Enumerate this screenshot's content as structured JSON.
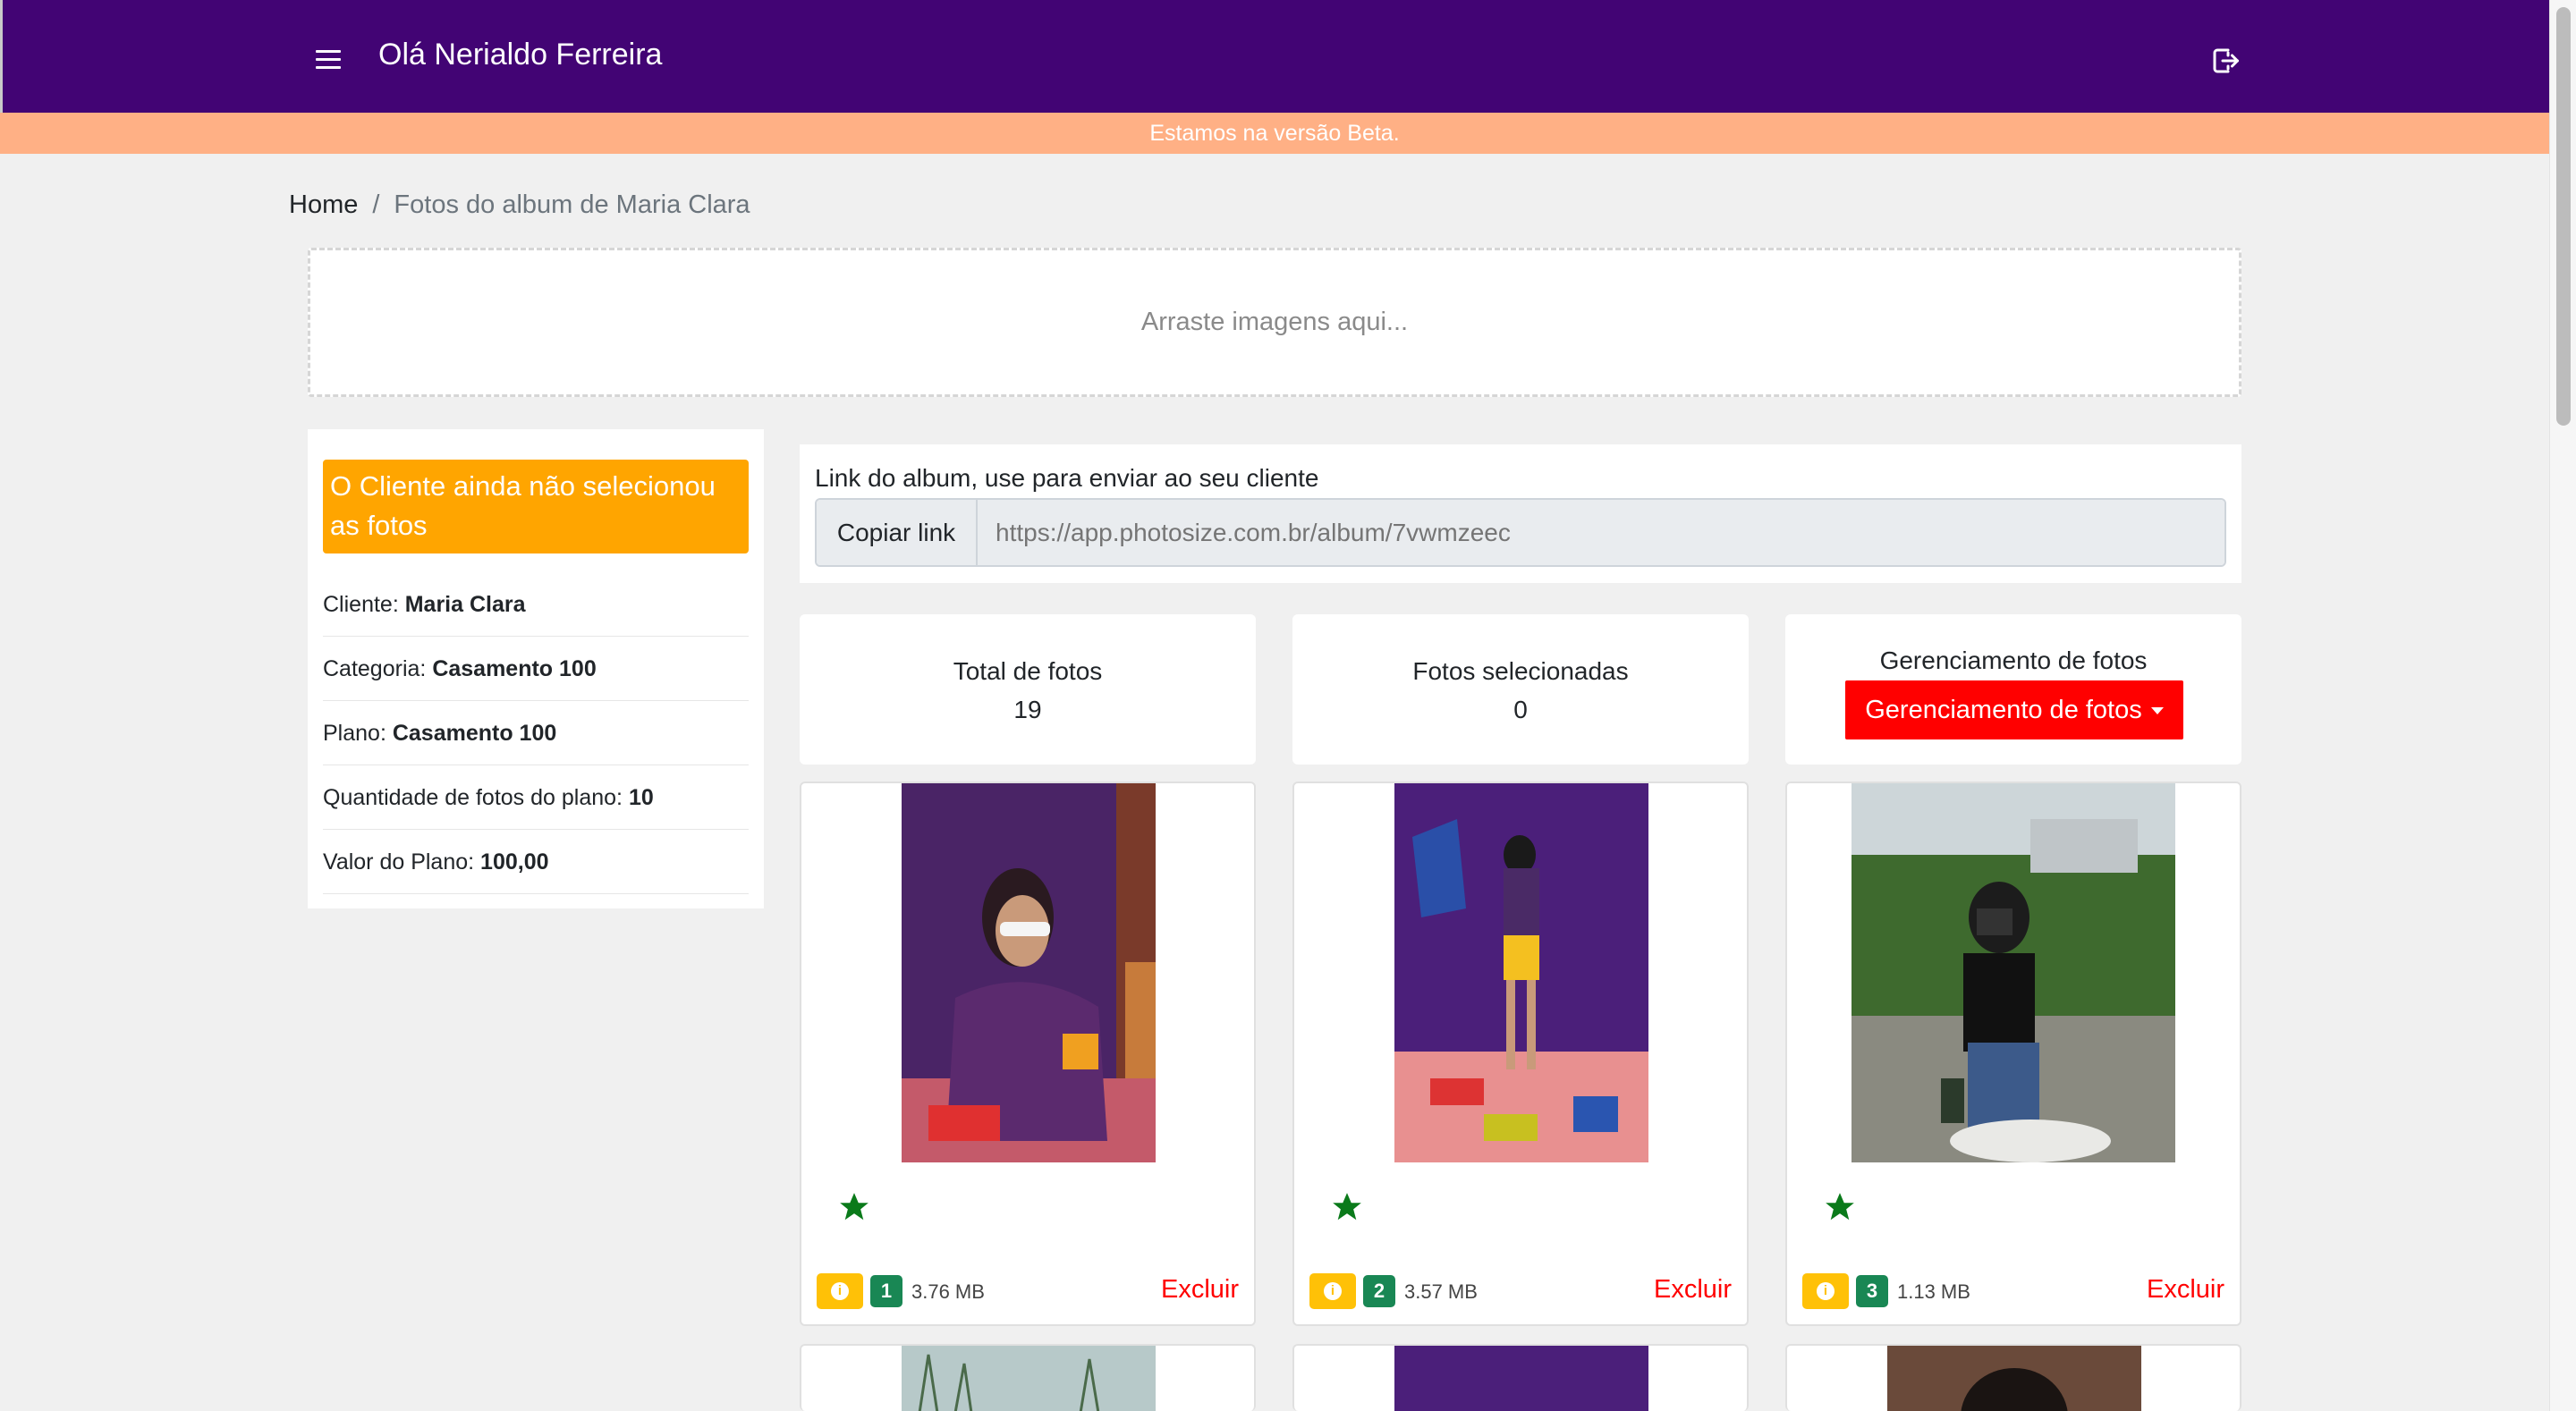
{
  "navbar": {
    "greeting": "Olá Nerialdo Ferreira",
    "menu_icon": "hamburger-menu-icon",
    "logout_icon": "logout-icon",
    "background": "#420474"
  },
  "banner": {
    "text": "Estamos na versão Beta.",
    "background": "#ffb085"
  },
  "breadcrumb": {
    "home": "Home",
    "separator": "/",
    "current": "Fotos do album de Maria Clara"
  },
  "dropzone": {
    "text": "Arraste imagens aqui..."
  },
  "sidebar": {
    "status_alert": "O Cliente ainda não selecionou as fotos",
    "status_color": "#ffa500",
    "rows": [
      {
        "label": "Cliente:",
        "value": "Maria Clara"
      },
      {
        "label": "Categoria:",
        "value": "Casamento 100"
      },
      {
        "label": "Plano:",
        "value": "Casamento 100"
      },
      {
        "label": "Quantidade de fotos do plano:",
        "value": "10"
      },
      {
        "label": "Valor do Plano:",
        "value": "100,00"
      }
    ]
  },
  "album_link": {
    "label": "Link do album, use para enviar ao seu cliente",
    "copy_button": "Copiar link",
    "placeholder": "https://app.photosize.com.br/album/7vwmzeec"
  },
  "stats": {
    "total_title": "Total de fotos",
    "total_value": "19",
    "selected_title": "Fotos selecionadas",
    "selected_value": "0",
    "manage_title": "Gerenciamento de fotos",
    "manage_button": "Gerenciamento de fotos",
    "manage_button_color": "#ff0000"
  },
  "photos": [
    {
      "number": "1",
      "size": "3.76 MB",
      "delete": "Excluir",
      "favorite_icon": "star-icon",
      "info_icon": "info-icon"
    },
    {
      "number": "2",
      "size": "3.57 MB",
      "delete": "Excluir",
      "favorite_icon": "star-icon",
      "info_icon": "info-icon"
    },
    {
      "number": "3",
      "size": "1.13 MB",
      "delete": "Excluir",
      "favorite_icon": "star-icon",
      "info_icon": "info-icon"
    }
  ]
}
